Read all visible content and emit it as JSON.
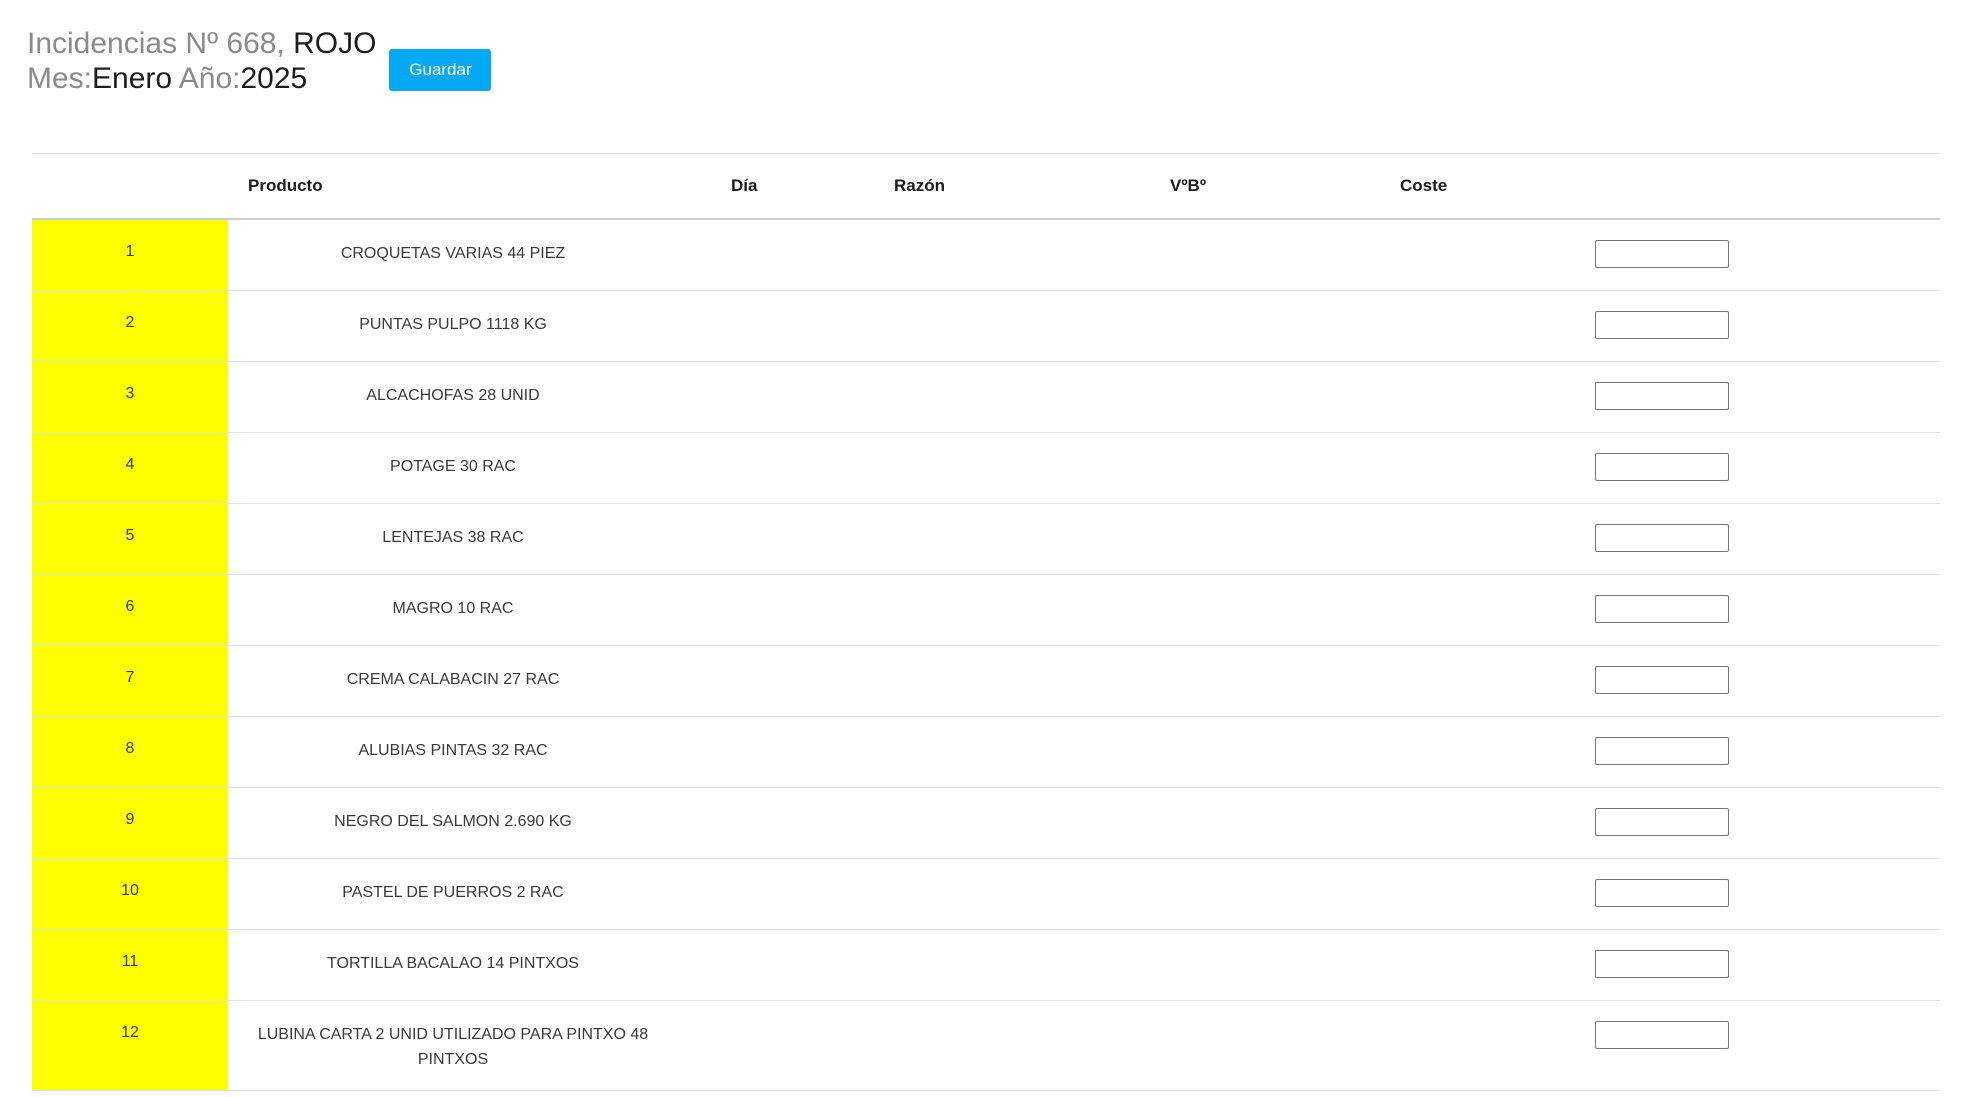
{
  "header": {
    "line1_prefix": "Incidencias Nº 668,",
    "line1_value": " ROJO",
    "mes_label": "Mes:",
    "mes_value": "Enero",
    "anio_label": " Año:",
    "anio_value": "2025",
    "save_label": "Guardar"
  },
  "table": {
    "columns": [
      "",
      "Producto",
      "Día",
      "Razón",
      "VºBº",
      "Coste",
      ""
    ],
    "rows": [
      {
        "num": "1",
        "producto": "CROQUETAS VARIAS 44 PIEZ"
      },
      {
        "num": "2",
        "producto": "PUNTAS PULPO 1118 KG"
      },
      {
        "num": "3",
        "producto": "ALCACHOFAS 28 UNID"
      },
      {
        "num": "4",
        "producto": "POTAGE 30 RAC"
      },
      {
        "num": "5",
        "producto": "LENTEJAS 38 RAC"
      },
      {
        "num": "6",
        "producto": "MAGRO 10 RAC"
      },
      {
        "num": "7",
        "producto": "CREMA CALABACIN 27 RAC"
      },
      {
        "num": "8",
        "producto": "ALUBIAS PINTAS 32 RAC"
      },
      {
        "num": "9",
        "producto": "NEGRO DEL SALMON 2.690 KG"
      },
      {
        "num": "10",
        "producto": "PASTEL DE PUERROS 2 RAC"
      },
      {
        "num": "11",
        "producto": "TORTILLA BACALAO 14 PINTXOS"
      },
      {
        "num": "12",
        "producto": "LUBINA CARTA 2 UNID UTILIZADO PARA PINTXO 48 PINTXOS"
      }
    ]
  },
  "colors": {
    "row_number_bg": "#ffff00",
    "button_bg": "#03a9f4"
  }
}
